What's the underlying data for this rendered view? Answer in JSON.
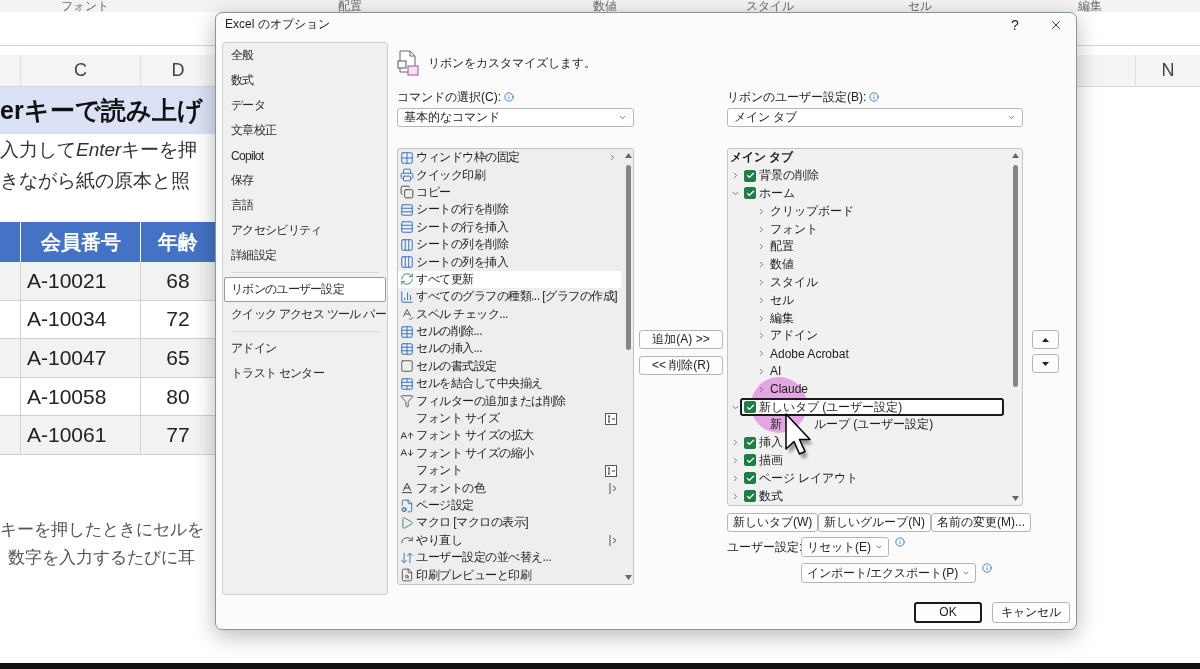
{
  "ribbon_groups": [
    "フォント",
    "配置",
    "数値",
    "スタイル",
    "セル",
    "編集"
  ],
  "sheet": {
    "left_column_headers": [
      "C",
      "D"
    ],
    "right_column_headers": [
      "N"
    ],
    "title": "erキーで読み上げ",
    "lines": [
      {
        "parts": [
          {
            "text": "入力して",
            "italic": false
          },
          {
            "text": "Enter",
            "italic": true
          },
          {
            "text": "キーを押",
            "italic": false
          }
        ]
      },
      {
        "parts": [
          {
            "text": "きながら紙の原本と照",
            "italic": false
          }
        ]
      }
    ],
    "table": {
      "columns": [
        "会員番号",
        "年齢"
      ],
      "rows": [
        [
          "A-10021",
          "68"
        ],
        [
          "A-10034",
          "72"
        ],
        [
          "A-10047",
          "65"
        ],
        [
          "A-10058",
          "80"
        ],
        [
          "A-10061",
          "77"
        ]
      ]
    },
    "notes": [
      "キーを押したときにセルを",
      "数字を入力するたびに耳"
    ]
  },
  "dialog": {
    "title": "Excel のオプション",
    "help": "?",
    "nav_groups": [
      [
        {
          "label": "全般",
          "selected": false
        },
        {
          "label": "数式",
          "selected": false
        },
        {
          "label": "データ",
          "selected": false
        },
        {
          "label": "文章校正",
          "selected": false
        },
        {
          "label": "Copilot",
          "selected": false
        },
        {
          "label": "保存",
          "selected": false
        },
        {
          "label": "言語",
          "selected": false
        },
        {
          "label": "アクセシビリティ",
          "selected": false
        },
        {
          "label": "詳細設定",
          "selected": false
        }
      ],
      [
        {
          "label": "リボンのユーザー設定",
          "selected": true
        },
        {
          "label": "クイック アクセス ツール バー",
          "selected": false
        }
      ],
      [
        {
          "label": "アドイン",
          "selected": false
        },
        {
          "label": "トラスト センター",
          "selected": false
        }
      ]
    ],
    "heading": "リボンをカスタマイズします。",
    "commands": {
      "label": "コマンドの選択(C):",
      "dropdown": "基本的なコマンド",
      "items": [
        {
          "label": "ウィンドウ枠の固定",
          "kind": "submenu",
          "selected": false
        },
        {
          "label": "クイック印刷",
          "kind": "command",
          "selected": false
        },
        {
          "label": "コピー",
          "kind": "command",
          "selected": false
        },
        {
          "label": "シートの行を削除",
          "kind": "command",
          "selected": false
        },
        {
          "label": "シートの行を挿入",
          "kind": "command",
          "selected": false
        },
        {
          "label": "シートの列を削除",
          "kind": "command",
          "selected": false
        },
        {
          "label": "シートの列を挿入",
          "kind": "command",
          "selected": false
        },
        {
          "label": "すべて更新",
          "kind": "command",
          "selected": true
        },
        {
          "label": "すべてのグラフの種類... [グラフの作成]",
          "kind": "command",
          "selected": false
        },
        {
          "label": "スペル チェック...",
          "kind": "command",
          "selected": false
        },
        {
          "label": "セルの削除...",
          "kind": "command",
          "selected": false
        },
        {
          "label": "セルの挿入...",
          "kind": "command",
          "selected": false
        },
        {
          "label": "セルの書式設定",
          "kind": "command",
          "selected": false
        },
        {
          "label": "セルを結合して中央揃え",
          "kind": "command",
          "selected": false
        },
        {
          "label": "フィルターの追加または削除",
          "kind": "command",
          "selected": false
        },
        {
          "label": "フォント サイズ",
          "kind": "combo",
          "selected": false
        },
        {
          "label": "フォント サイズの拡大",
          "kind": "command",
          "selected": false
        },
        {
          "label": "フォント サイズの縮小",
          "kind": "command",
          "selected": false
        },
        {
          "label": "フォント",
          "kind": "combo",
          "selected": false
        },
        {
          "label": "フォントの色",
          "kind": "split",
          "selected": false
        },
        {
          "label": "ページ設定",
          "kind": "command",
          "selected": false
        },
        {
          "label": "マクロ [マクロの表示]",
          "kind": "command",
          "selected": false
        },
        {
          "label": "やり直し",
          "kind": "split",
          "selected": false
        },
        {
          "label": "ユーザー設定の並べ替え...",
          "kind": "command",
          "selected": false
        },
        {
          "label": "印刷プレビューと印刷",
          "kind": "command",
          "selected": false
        }
      ]
    },
    "add_button": "追加(A) >>",
    "remove_button": "<< 削除(R)",
    "ribbon": {
      "label": "リボンのユーザー設定(B):",
      "dropdown": "メイン タブ",
      "tree": {
        "title": "メイン タブ",
        "items": [
          {
            "label": "背景の削除",
            "checked": true,
            "expanded": false,
            "selected": false
          },
          {
            "label": "ホーム",
            "checked": true,
            "expanded": true,
            "selected": false,
            "children": [
              {
                "label": "クリップボード",
                "expanded": false,
                "selected": false
              },
              {
                "label": "フォント",
                "expanded": false,
                "selected": false
              },
              {
                "label": "配置",
                "expanded": false,
                "selected": false
              },
              {
                "label": "数値",
                "expanded": false,
                "selected": false
              },
              {
                "label": "スタイル",
                "expanded": false,
                "selected": false
              },
              {
                "label": "セル",
                "expanded": false,
                "selected": false
              },
              {
                "label": "編集",
                "expanded": false,
                "selected": false
              },
              {
                "label": "アドイン",
                "expanded": false,
                "selected": false
              },
              {
                "label": "Adobe Acrobat",
                "expanded": false,
                "selected": false
              },
              {
                "label": "AI",
                "expanded": false,
                "selected": false
              },
              {
                "label": "Claude",
                "expanded": false,
                "selected": false
              }
            ]
          },
          {
            "label": "新しいタブ (ユーザー設定)",
            "checked": true,
            "expanded": true,
            "selected": true,
            "children": [
              {
                "label_parts": [
                  "新",
                  "ループ (ユーザー設定)"
                ],
                "selected": false
              }
            ]
          },
          {
            "label": "挿入",
            "checked": true,
            "expanded": false,
            "selected": false
          },
          {
            "label": "描画",
            "checked": true,
            "expanded": false,
            "selected": false
          },
          {
            "label": "ページ レイアウト",
            "checked": true,
            "expanded": false,
            "selected": false
          },
          {
            "label": "数式",
            "checked": true,
            "expanded": false,
            "selected": false
          }
        ]
      }
    },
    "tree_buttons": [
      "新しいタブ(W)",
      "新しいグループ(N)",
      "名前の変更(M)..."
    ],
    "customizations_label": "ユーザー設定:",
    "reset_button": "リセット(E)",
    "import_export_button": "インポート/エクスポート(P)",
    "ok_button": "OK",
    "cancel_button": "キャンセル"
  }
}
